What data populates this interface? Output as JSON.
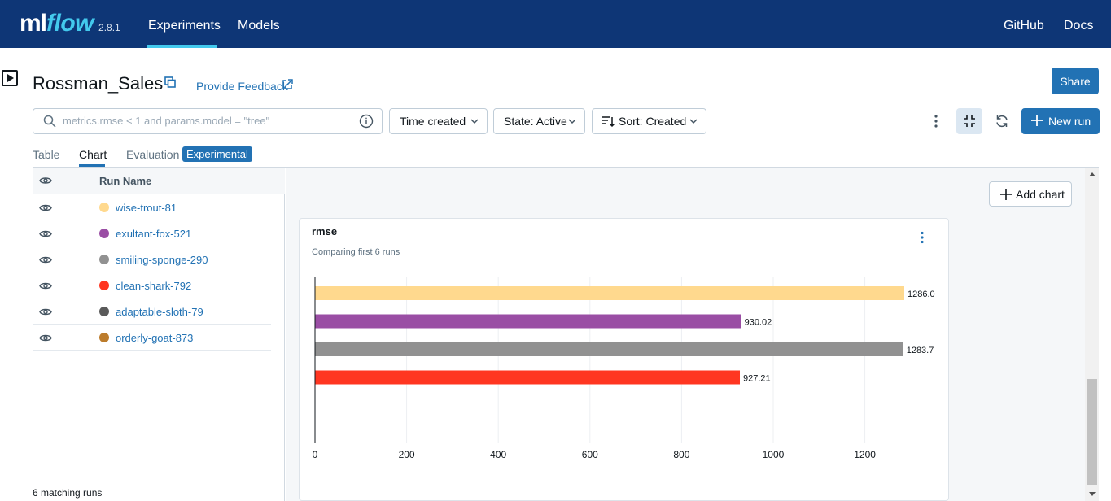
{
  "nav": {
    "logo_ml": "ml",
    "logo_flow": "flow",
    "version": "2.8.1",
    "experiments": "Experiments",
    "models": "Models",
    "github": "GitHub",
    "docs": "Docs"
  },
  "header": {
    "title": "Rossman_Sales",
    "feedback": "Provide Feedback",
    "share": "Share"
  },
  "filters": {
    "search_placeholder": "metrics.rmse < 1 and params.model = \"tree\"",
    "time_created": "Time created",
    "state": "State: Active",
    "sort": "Sort: Created",
    "new_run": "New run"
  },
  "tabs": {
    "table": "Table",
    "chart": "Chart",
    "evaluation": "Evaluation",
    "experimental": "Experimental"
  },
  "runs_table": {
    "header": "Run Name",
    "rows": [
      {
        "name": "wise-trout-81",
        "color": "#ffd98e"
      },
      {
        "name": "exultant-fox-521",
        "color": "#9a4ea4"
      },
      {
        "name": "smiling-sponge-290",
        "color": "#919191"
      },
      {
        "name": "clean-shark-792",
        "color": "#ff3621"
      },
      {
        "name": "adaptable-sloth-79",
        "color": "#5a5a5a"
      },
      {
        "name": "orderly-goat-873",
        "color": "#bc7c2c"
      }
    ],
    "matching": "6 matching runs"
  },
  "chart_area": {
    "add_chart": "Add chart"
  },
  "colors": {
    "nav_bg": "#0e3676",
    "accent": "#2272b4",
    "nav_accent": "#43c9ed"
  },
  "chart_data": {
    "type": "bar",
    "orientation": "horizontal",
    "title": "rmse",
    "subtitle": "Comparing first 6 runs",
    "categories": [
      "wise-trout-81",
      "exultant-fox-521",
      "smiling-sponge-290",
      "clean-shark-792"
    ],
    "values": [
      1286.0,
      930.02,
      1283.7,
      927.21
    ],
    "value_labels": [
      "1286.0",
      "930.02",
      "1283.7",
      "927.21"
    ],
    "colors": [
      "#ffd98e",
      "#9a4ea4",
      "#919191",
      "#ff3621"
    ],
    "xlim": [
      0,
      1286
    ],
    "xticks": [
      0,
      200,
      400,
      600,
      800,
      1000,
      1200
    ],
    "grid": true
  }
}
